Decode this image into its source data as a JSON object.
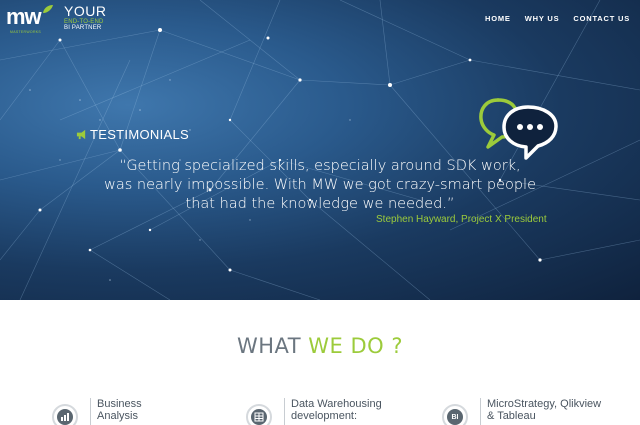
{
  "header": {
    "logo_text": "mw",
    "logo_subtitle": "MASTERWORKS",
    "tagline_big": "YOUR",
    "tagline_small1": "END-TO-END",
    "tagline_small2": "BI PARTNER"
  },
  "nav": {
    "items": [
      "HOME",
      "WHY US",
      "CONTACT US"
    ]
  },
  "testimonials": {
    "heading": "TESTIMONIALS",
    "quote_lines": [
      "“Getting specialized skills, especially around SDK work,",
      "was nearly impossible. With MW we got crazy-smart people",
      "that had the knowledge we needed.”"
    ],
    "author": "Stephen Hayward, Project X President",
    "icon": "chat-bubbles-icon"
  },
  "what_we_do": {
    "title_part1": "WHAT ",
    "title_part2": "WE DO ?",
    "services": [
      {
        "icon": "analytics-icon",
        "line1": "Business",
        "line2": "Analysis"
      },
      {
        "icon": "database-icon",
        "line1": "Data Warehousing",
        "line2": "development:"
      },
      {
        "icon": "bi-icon",
        "badge": "BI",
        "line1": "MicroStrategy, Qlikview",
        "line2": "& Tableau"
      }
    ]
  },
  "colors": {
    "accent_green": "#9ccb3b",
    "hero_dark": "#0f223d",
    "hero_light": "#3f77ad",
    "title_gray": "#6b7680"
  }
}
